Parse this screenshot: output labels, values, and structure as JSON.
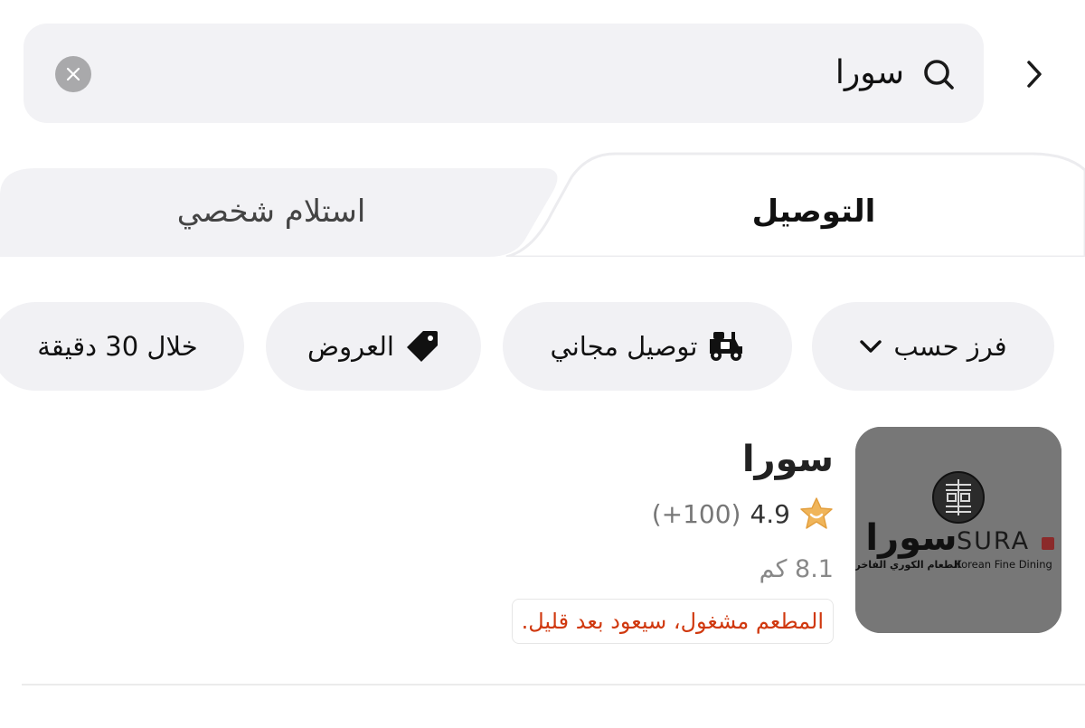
{
  "search": {
    "query": "سورا"
  },
  "tabs": [
    {
      "label": "التوصيل",
      "active": true
    },
    {
      "label": "استلام شخصي",
      "active": false
    }
  ],
  "filters": [
    {
      "label": "فرز حسب",
      "icon": "chevron-down-icon"
    },
    {
      "label": "توصيل مجاني",
      "icon": "scooter-icon"
    },
    {
      "label": "العروض",
      "icon": "tag-icon"
    },
    {
      "label": "خلال 30 دقيقة"
    }
  ],
  "restaurant": {
    "name": "سورا",
    "rating": "4.9",
    "rating_count": "(100+)",
    "distance": "8.1 كم",
    "status": "المطعم مشغول، سيعود بعد قليل.",
    "logo": {
      "arabic_name": "سورا",
      "latin_name": "SURA",
      "arabic_tagline": "الطعام الكوري الفاخر",
      "latin_tagline": "Korean Fine Dining"
    }
  },
  "colors": {
    "accent_star": "#f0b55a",
    "status_text": "#d0380e",
    "chip_bg": "#f1f1f4",
    "logo_bg": "#777777"
  }
}
